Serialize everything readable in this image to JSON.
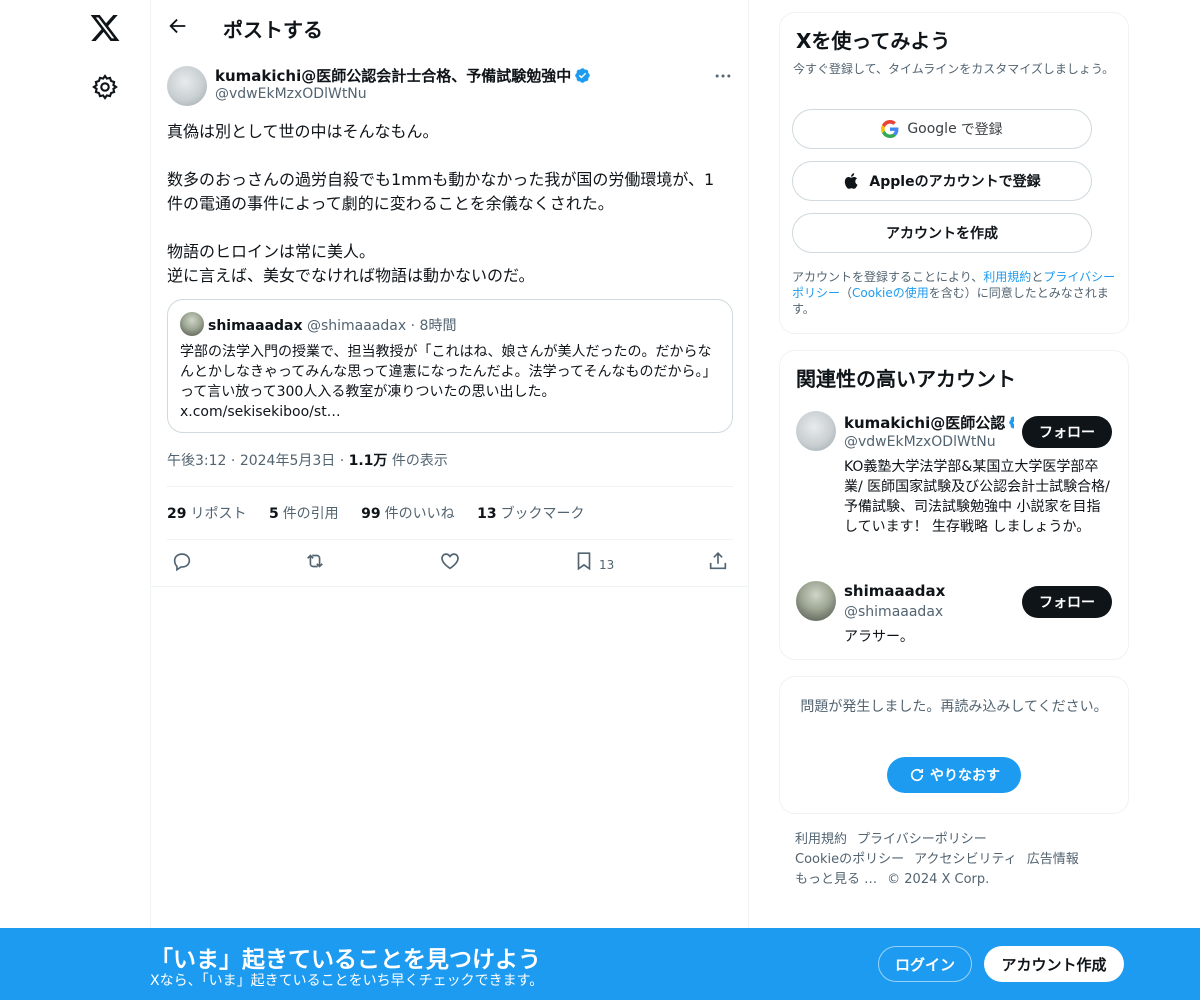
{
  "colors": {
    "accent": "#1d9bf0",
    "text": "#0f1419",
    "secondary": "#536471",
    "border": "#eff3f4",
    "follow_button": "#0f1419"
  },
  "nav": {
    "icons": [
      "x-logo-icon",
      "gear-icon"
    ]
  },
  "header": {
    "title": "ポストする"
  },
  "post": {
    "author_name": "kumakichi@医師公認会計士合格、予備試験勉強中",
    "author_handle": "@vdwEkMzxODlWtNu",
    "body": "真偽は別として世の中はそんなもん。\n\n数多のおっさんの過労自殺でも1mmも動かなかった我が国の労働環境が、1件の電通の事件によって劇的に変わることを余儀なくされた。\n\n物語のヒロインは常に美人。\n逆に言えば、美女でなければ物語は動かないのだ。",
    "quote": {
      "name": "shimaaadax",
      "handle": "@shimaaadax",
      "separator": "·",
      "time": "8時間",
      "text": "学部の法学入門の授業で、担当教授が「これはね、娘さんが美人だったの。だからなんとかしなきゃってみんな思って違憲になったんだよ。法学ってそんなものだから。」って言い放って300人入る教室が凍りついたの思い出した。",
      "link": "x.com/sekisekiboo/st…"
    },
    "time": "午後3:12",
    "date": "2024年5月3日",
    "dot": "·",
    "views_count": "1.1万",
    "views_label": "件の表示",
    "stats": {
      "reposts_count": "29",
      "reposts_label": "リポスト",
      "quotes_count": "5",
      "quotes_label": "件の引用",
      "likes_count": "99",
      "likes_label": "件のいいね",
      "bookmarks_count": "13",
      "bookmarks_label": "ブックマーク"
    },
    "actions": {
      "reply_icon": "reply-icon",
      "repost_icon": "repost-icon",
      "like_icon": "heart-icon",
      "bookmark_icon": "bookmark-icon",
      "bookmark_count": "13",
      "share_icon": "share-icon"
    }
  },
  "signup_card": {
    "title": "Xを使ってみよう",
    "subtitle": "今すぐ登録して、タイムラインをカスタマイズしましょう。",
    "google_label_brand": "Google",
    "google_label_rest": "で登録",
    "apple_label": "Appleのアカウントで登録",
    "create_label": "アカウントを作成",
    "legal_1": "アカウントを登録することにより、",
    "legal_link_terms": "利用規約",
    "legal_2": "と",
    "legal_link_privacy": "プライバシーポリシー",
    "legal_3": "（",
    "legal_link_cookie": "Cookieの使用",
    "legal_4": "を含む）に同意したとみなされます。"
  },
  "relevant": {
    "title": "関連性の高いアカウント",
    "follow_label": "フォロー",
    "accounts": [
      {
        "name": "kumakichi@医師公認",
        "handle": "@vdwEkMzxODlWtNu",
        "bio": "KO義塾大学法学部&某国立大学医学部卒業/ 医師国家試験及び公認会計士試験合格/予備試験、司法試験勉強中 小説家を目指しています！ 生存戦略 しましょうか。"
      },
      {
        "name": "shimaaadax",
        "handle": "@shimaaadax",
        "bio": "アラサー。"
      }
    ]
  },
  "error_card": {
    "text": "問題が発生しました。再読み込みしてください。",
    "retry_label": "やりなおす"
  },
  "footer": {
    "terms": "利用規約",
    "privacy": "プライバシーポリシー",
    "cookie": "Cookieのポリシー",
    "accessibility": "アクセシビリティ",
    "ads": "広告情報",
    "more": "もっと見る …",
    "copyright": "© 2024 X Corp."
  },
  "banner": {
    "title": "「いま」起きていることを見つけよう",
    "subtitle": "Xなら、「いま」起きていることをいち早くチェックできます。",
    "login_label": "ログイン",
    "signup_label": "アカウント作成"
  }
}
